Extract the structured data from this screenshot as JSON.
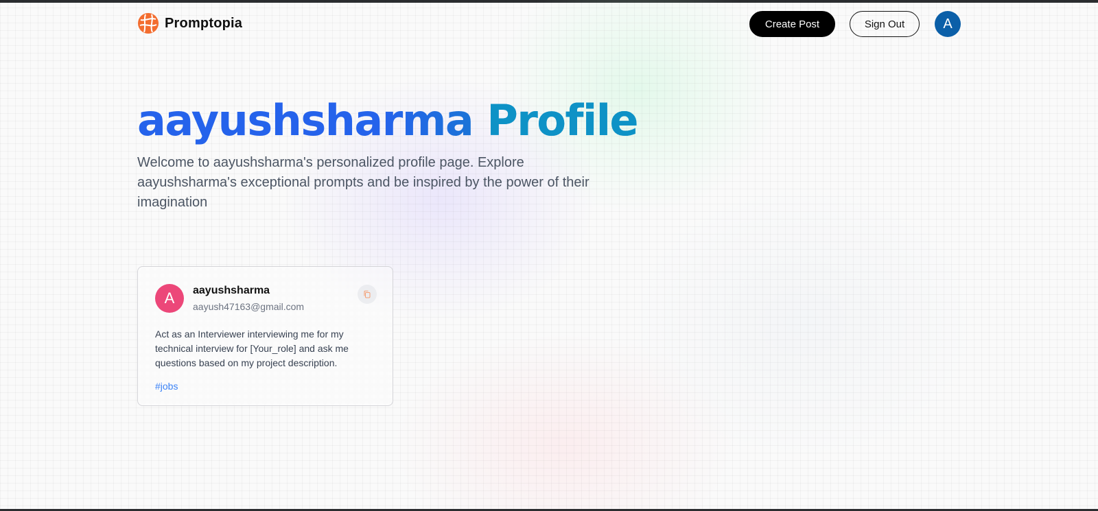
{
  "nav": {
    "brand": "Promptopia",
    "create_label": "Create Post",
    "signout_label": "Sign Out",
    "avatar_initial": "A"
  },
  "hero": {
    "title_name": "aayushsharma",
    "title_suffix": "Profile",
    "description": "Welcome to aayushsharma's personalized profile page. Explore aayushsharma's exceptional prompts and be inspired by the power of their imagination"
  },
  "posts": [
    {
      "avatar_initial": "A",
      "username": "aayushsharma",
      "email": "aayush47163@gmail.com",
      "prompt": "Act as an Interviewer interviewing me for my technical interview for [Your_role] and ask me questions based on my project description.",
      "tag": "#jobs"
    }
  ],
  "icons": {
    "logo": "promptopia-logo-icon",
    "copy": "copy-icon"
  },
  "colors": {
    "brand_orange": "#f36d2f",
    "title_blue": "#2563eb",
    "title_cyan": "#0891b2",
    "nav_avatar": "#0b5fa8",
    "card_avatar": "#ec4779",
    "tag_blue": "#3b82f6"
  }
}
